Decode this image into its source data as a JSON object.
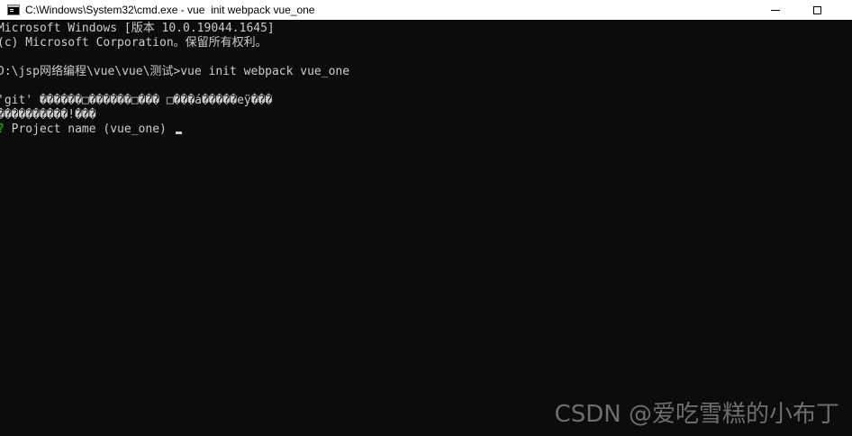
{
  "window": {
    "title": "C:\\Windows\\System32\\cmd.exe - vue  init webpack vue_one",
    "icon": "cmd-console-icon",
    "buttons": [
      "minimize",
      "maximize"
    ]
  },
  "console": {
    "line1": "Microsoft Windows [版本 10.0.19044.1645]",
    "line2": "(c) Microsoft Corporation。保留所有权利。",
    "line3": "D:\\jsp网络编程\\vue\\vue\\测试>vue init webpack vue_one",
    "line4": "'git' ������□������□��� □���á�����eÿ���",
    "line5": "����������!���",
    "prompt_mark": "?",
    "prompt_text": " Project name (vue_one) "
  },
  "colors": {
    "background": "#0c0c0c",
    "text": "#cccccc",
    "prompt_mark": "#16c60c",
    "titlebar": "#ffffff"
  },
  "watermark": "CSDN @爱吃雪糕的小布丁"
}
